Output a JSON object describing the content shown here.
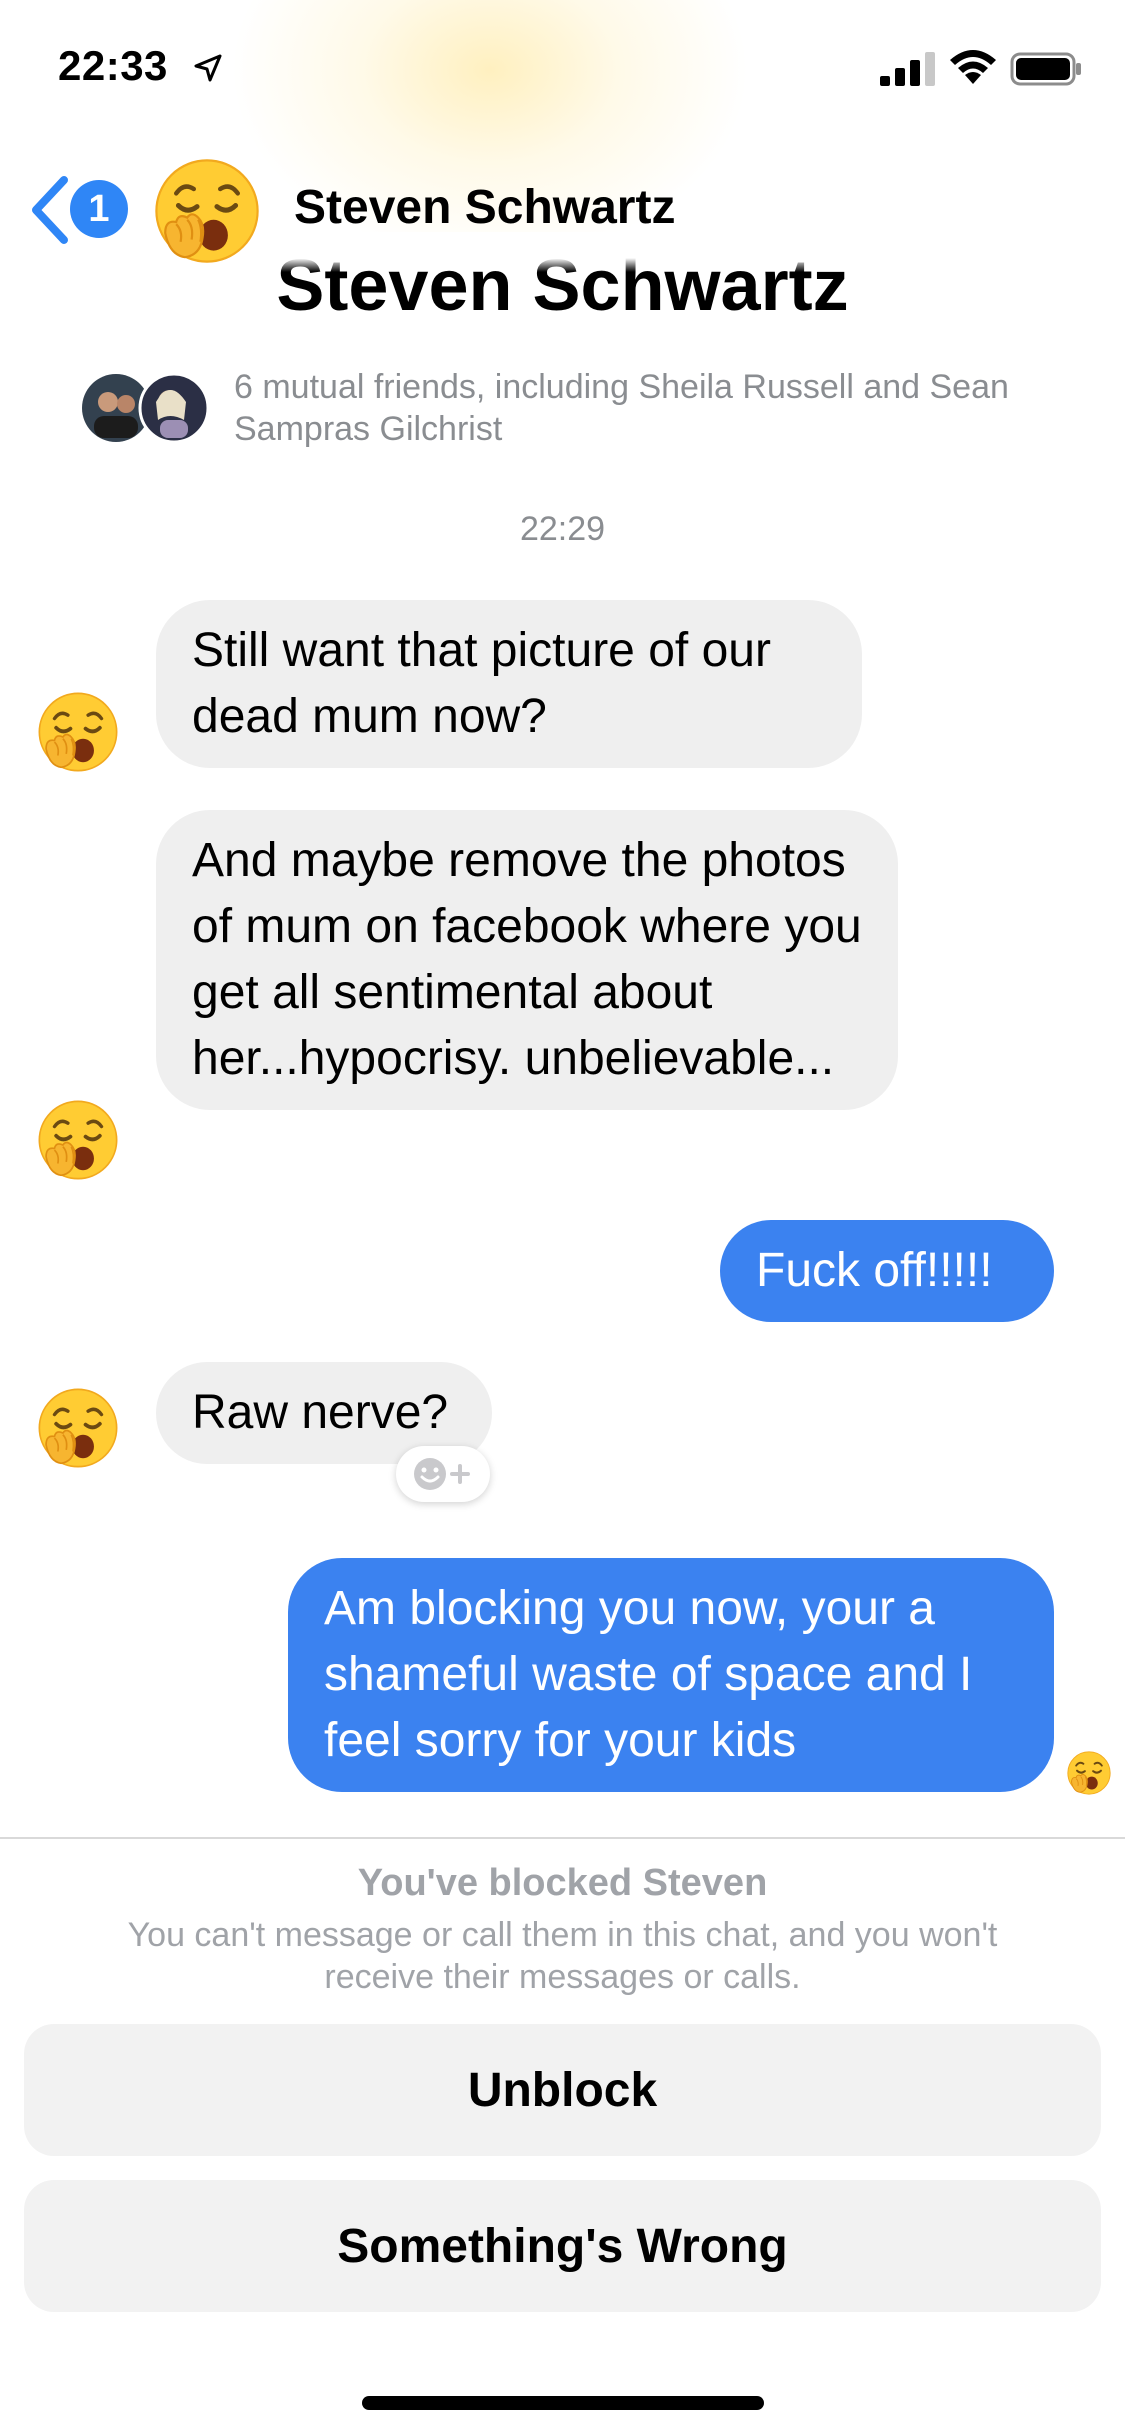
{
  "status_bar": {
    "time": "22:33"
  },
  "header": {
    "unread_count": "1",
    "contact_name": "Steven Schwartz",
    "avatar_icon": "yawning-face-emoji"
  },
  "profile": {
    "name": "Steven Schwartz",
    "mutual_friends": "6 mutual friends, including Sheila Russell and Sean Sampras Gilchrist"
  },
  "conversation": {
    "timestamp": "22:29",
    "messages": [
      {
        "from": "them",
        "text": "Still want that picture of our dead mum now?"
      },
      {
        "from": "them",
        "text": "And maybe remove the photos of mum on facebook where you get all sentimental about her...hypocrisy. unbelievable..."
      },
      {
        "from": "me",
        "text": "Fuck off!!!!!"
      },
      {
        "from": "them",
        "text": "Raw nerve?"
      },
      {
        "from": "me",
        "text": "Am blocking you now, your a shameful waste of space and I feel sorry for your kids"
      }
    ]
  },
  "blocked_panel": {
    "title": "You've blocked Steven",
    "description": "You can't message or call them in this chat, and you won't receive their messages or calls.",
    "unblock_label": "Unblock",
    "report_label": "Something's Wrong"
  },
  "colors": {
    "accent_blue": "#3b82f0",
    "incoming_bubble": "#efefef",
    "secondary_text": "#8a8d91"
  }
}
